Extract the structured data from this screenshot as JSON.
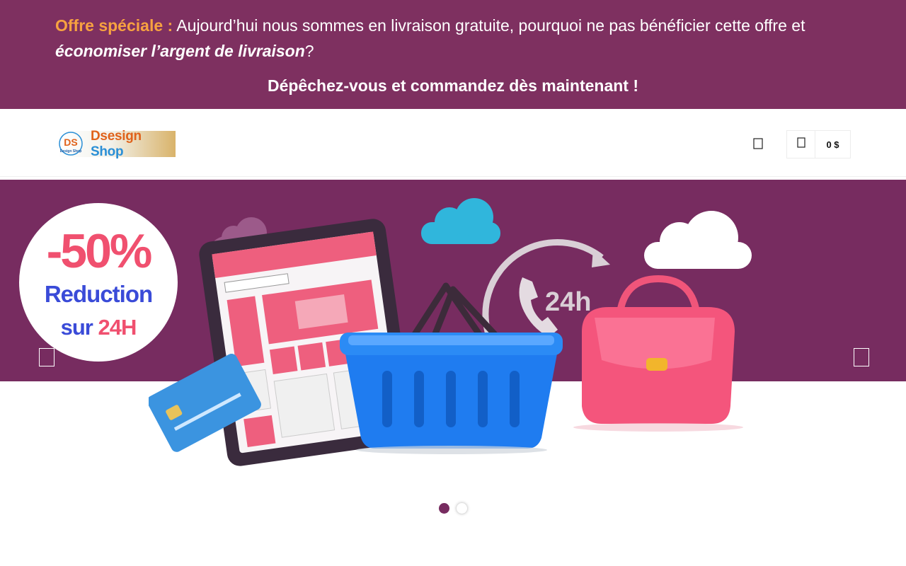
{
  "promo": {
    "label": "Offre spéciale :",
    "text_before": " Aujourd’hui nous sommes en livraison gratuite, pourquoi ne pas bénéficier cette offre et",
    "emphasis": "économiser l’argent de livraison",
    "text_after": "?",
    "cta": "Dépêchez-vous et commandez dès maintenant !"
  },
  "header": {
    "logo_text_part1": "Dsesign",
    "logo_text_part2": " Shop",
    "logo_mark_text": "DS",
    "logo_mark_caption": "Design Shop",
    "search_icon": "search-icon",
    "cart_icon": "cart-icon",
    "cart_total": "0 $"
  },
  "slider": {
    "badge_percent": "-50%",
    "badge_word": "Reduction",
    "badge_sub_1": "sur",
    "badge_sub_2": "24H",
    "clock_label": "24h",
    "slides_count": 2,
    "active_slide": 1
  },
  "colors": {
    "promo_bg": "#7e3060",
    "promo_label": "#f7a240",
    "slider_bg": "#772c60",
    "accent_pink": "#f0506f",
    "accent_blue": "#3a4bd8"
  }
}
